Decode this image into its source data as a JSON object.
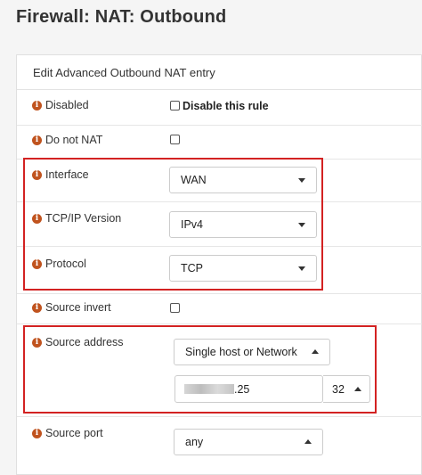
{
  "page": {
    "title": "Firewall: NAT: Outbound"
  },
  "panel": {
    "heading": "Edit Advanced Outbound NAT entry"
  },
  "icons": {
    "info": "info-circle-icon",
    "info_glyph": "i"
  },
  "colors": {
    "info_icon": "#c0531e",
    "highlight": "#d32222"
  },
  "fields": {
    "disabled": {
      "label": "Disabled",
      "checkbox_label": "Disable this rule",
      "checked": false
    },
    "do_not_nat": {
      "label": "Do not NAT",
      "checked": false
    },
    "interface": {
      "label": "Interface",
      "value": "WAN"
    },
    "tcpip_version": {
      "label": "TCP/IP Version",
      "value": "IPv4"
    },
    "protocol": {
      "label": "Protocol",
      "value": "TCP"
    },
    "source_invert": {
      "label": "Source invert",
      "checked": false
    },
    "source_address": {
      "label": "Source address",
      "type_value": "Single host or Network",
      "address_suffix": ".25",
      "mask": "32"
    },
    "source_port": {
      "label": "Source port",
      "value": "any"
    }
  }
}
